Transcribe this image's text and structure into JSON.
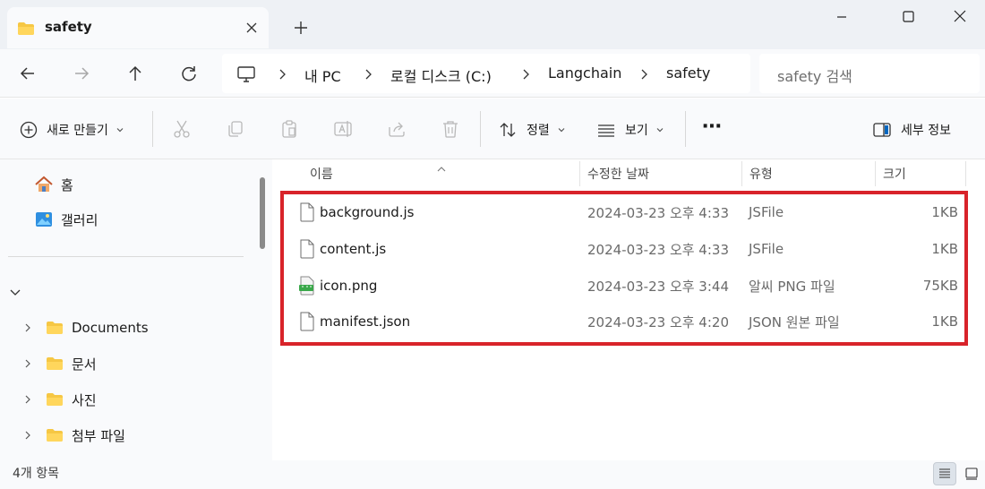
{
  "window": {
    "tab_title": "safety",
    "icons": {
      "close": "close-icon",
      "new_tab": "plus-icon",
      "minimize": "minimize-icon",
      "maximize": "maximize-icon",
      "window_close": "close-icon"
    }
  },
  "address_bar": {
    "breadcrumbs": [
      "내 PC",
      "로컬 디스크 (C:)",
      "Langchain",
      "safety"
    ],
    "search_placeholder": "safety 검색"
  },
  "command_bar": {
    "new_label": "새로 만들기",
    "sort_label": "정렬",
    "view_label": "보기",
    "more_label": "⋯",
    "details_label": "세부 정보"
  },
  "sidebar": {
    "quick": [
      {
        "label": "홈",
        "icon": "home-icon"
      },
      {
        "label": "갤러리",
        "icon": "gallery-icon"
      }
    ],
    "folders": [
      {
        "label": "Documents",
        "icon": "folder-icon"
      },
      {
        "label": "문서",
        "icon": "folder-icon"
      },
      {
        "label": "사진",
        "icon": "folder-icon"
      },
      {
        "label": "첨부 파일",
        "icon": "folder-icon"
      }
    ]
  },
  "columns": {
    "name": "이름",
    "modified": "수정한 날짜",
    "type": "유형",
    "size": "크기"
  },
  "files": [
    {
      "name": "background.js",
      "modified": "2024-03-23 오후 4:33",
      "type": "JSFile",
      "size": "1KB",
      "icon": "file-icon"
    },
    {
      "name": "content.js",
      "modified": "2024-03-23 오후 4:33",
      "type": "JSFile",
      "size": "1KB",
      "icon": "file-icon"
    },
    {
      "name": "icon.png",
      "modified": "2024-03-23 오후 3:44",
      "type": "알씨 PNG 파일",
      "size": "75KB",
      "icon": "png-image-icon"
    },
    {
      "name": "manifest.json",
      "modified": "2024-03-23 오후 4:20",
      "type": "JSON 원본 파일",
      "size": "1KB",
      "icon": "file-icon"
    }
  ],
  "status": {
    "item_count": "4개 항목"
  },
  "colors": {
    "highlight": "#d8232a",
    "folder": "#f6c744",
    "accent": "#0067c0"
  }
}
